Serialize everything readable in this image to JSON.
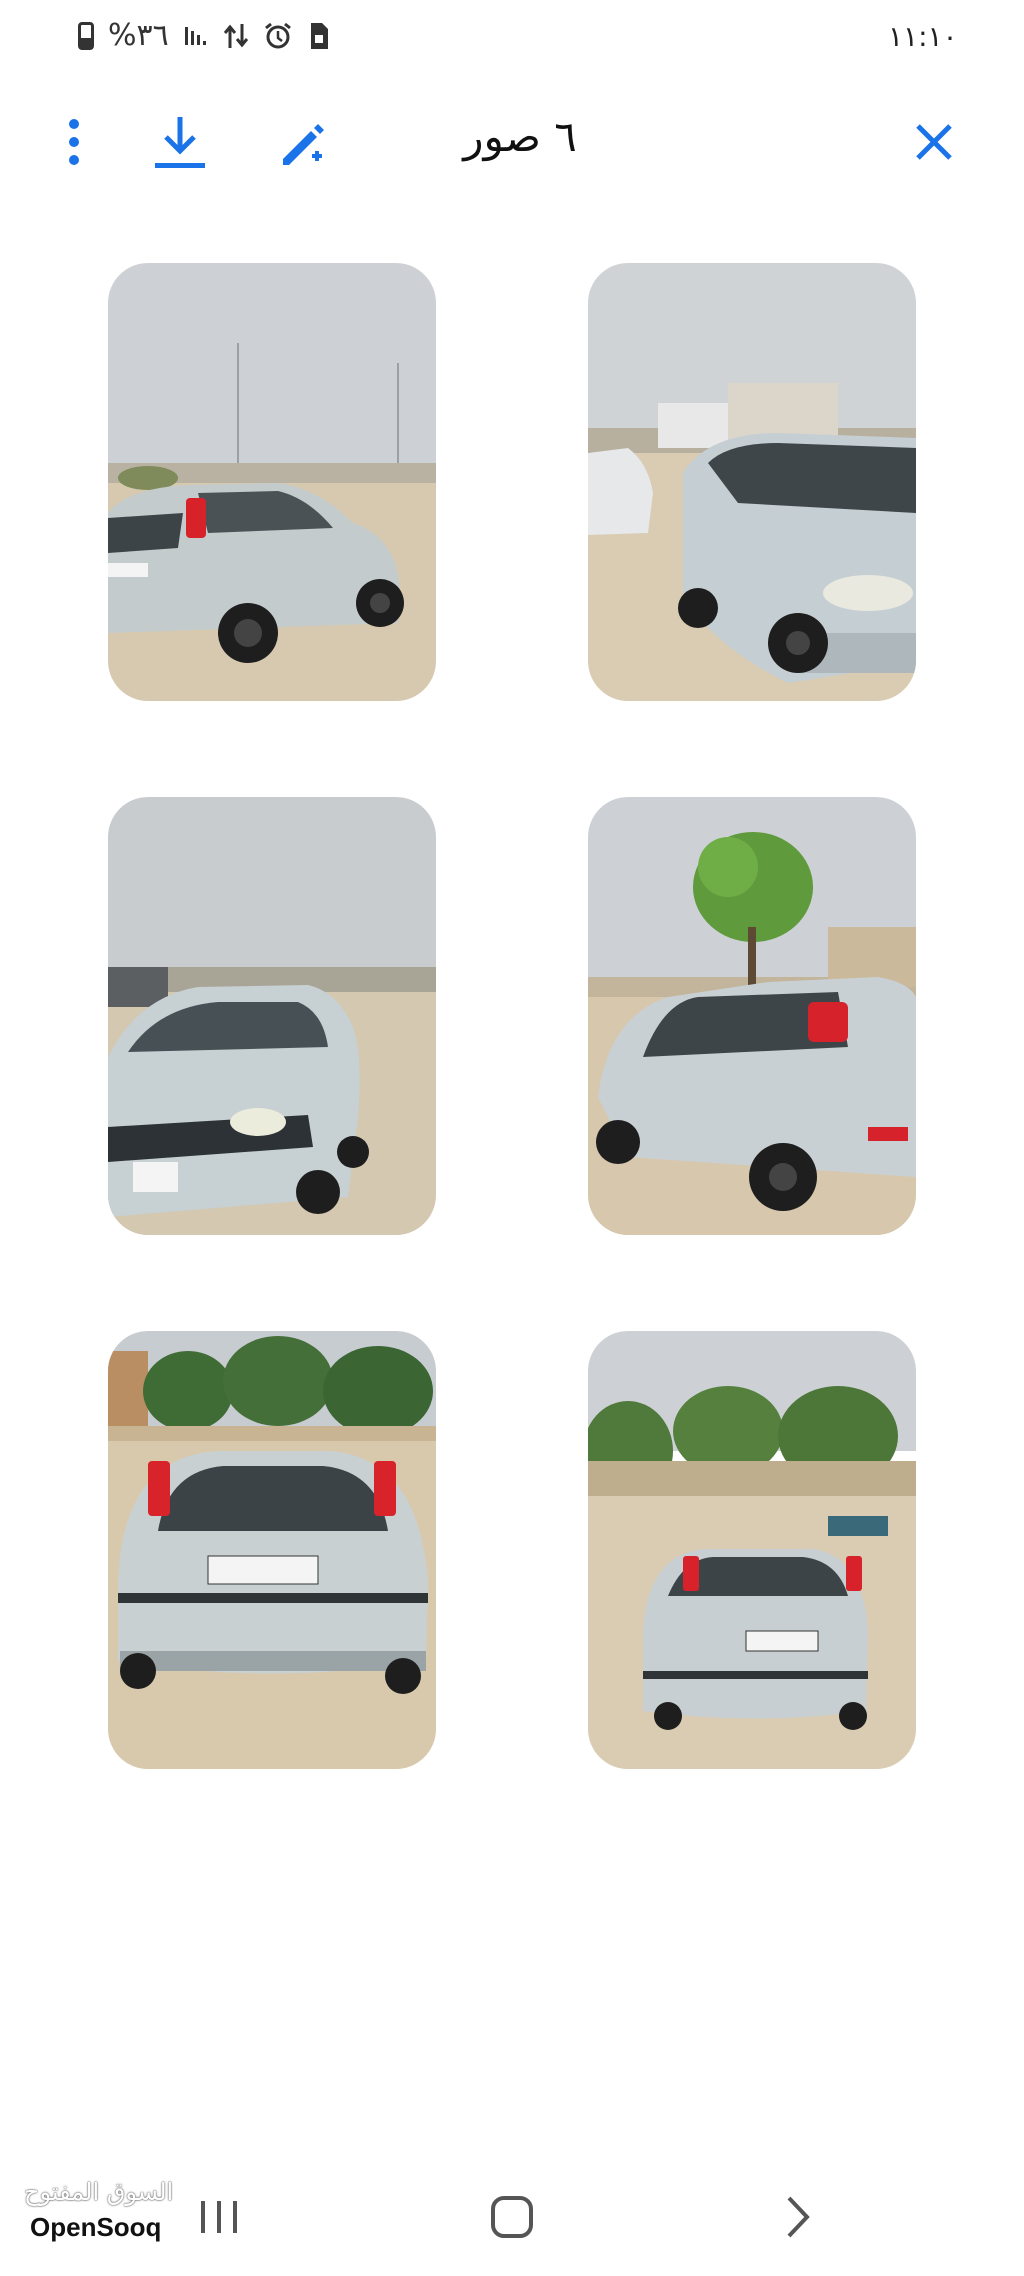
{
  "status_bar": {
    "time": "١١:١٠",
    "battery_percent": "%٣٦",
    "icons": [
      "battery-icon",
      "signal-icon",
      "data-arrows-icon",
      "alarm-icon",
      "sim-icon"
    ]
  },
  "app_bar": {
    "title": "٦ صور",
    "icons": [
      "more-vert-icon",
      "download-icon",
      "edit-magic-icon",
      "close-icon"
    ],
    "accent_color": "#1a73e8"
  },
  "photos": [
    {
      "label": "car-rear-left-view"
    },
    {
      "label": "car-front-right-view"
    },
    {
      "label": "car-front-view"
    },
    {
      "label": "car-left-side-view"
    },
    {
      "label": "car-rear-view-closeup"
    },
    {
      "label": "car-rear-view-distance"
    }
  ],
  "nav_bar": {
    "icons": [
      "recents-icon",
      "home-icon",
      "back-icon"
    ]
  },
  "watermark": {
    "arabic": "السوق المفتوح",
    "english": "OpenSooq"
  }
}
